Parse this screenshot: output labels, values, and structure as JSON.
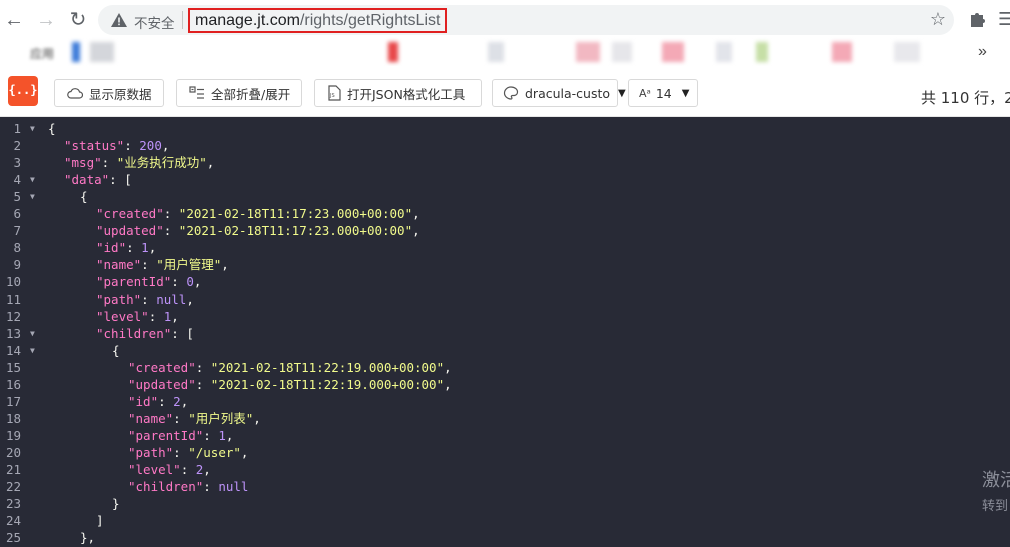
{
  "browser": {
    "security_label": "不安全",
    "url": {
      "host": "manage.jt.com",
      "path": "/rights/getRightsList"
    },
    "bookmarks_first": "应用"
  },
  "toolbar": {
    "logo_text": "{..}",
    "show_raw": "显示原数据",
    "fold_toggle": "全部折叠/展开",
    "open_json_tool": "打开JSON格式化工具",
    "theme": "dracula-custo",
    "font_size": "14",
    "line_count": "共 110 行，2"
  },
  "colors": {
    "editor_bg": "#282a36",
    "key": "#ff79c6",
    "string": "#f1fa8c",
    "number": "#bd93f9",
    "logo": "#f4532a",
    "url_highlight": "#e02020"
  },
  "lines": [
    {
      "n": "1",
      "fold": true,
      "indent": 0,
      "parts": [
        [
          "p",
          "{"
        ]
      ]
    },
    {
      "n": "2",
      "indent": 1,
      "parts": [
        [
          "k",
          "\"status\""
        ],
        [
          "p",
          ": "
        ],
        [
          "n",
          "200"
        ],
        [
          "p",
          ","
        ]
      ]
    },
    {
      "n": "3",
      "indent": 1,
      "parts": [
        [
          "k",
          "\"msg\""
        ],
        [
          "p",
          ": "
        ],
        [
          "s",
          "\"业务执行成功\""
        ],
        [
          "p",
          ","
        ]
      ]
    },
    {
      "n": "4",
      "fold": true,
      "indent": 1,
      "parts": [
        [
          "k",
          "\"data\""
        ],
        [
          "p",
          ": ["
        ]
      ]
    },
    {
      "n": "5",
      "fold": true,
      "indent": 2,
      "parts": [
        [
          "p",
          "{"
        ]
      ]
    },
    {
      "n": "6",
      "indent": 3,
      "parts": [
        [
          "k",
          "\"created\""
        ],
        [
          "p",
          ": "
        ],
        [
          "s",
          "\"2021-02-18T11:17:23.000+00:00\""
        ],
        [
          "p",
          ","
        ]
      ]
    },
    {
      "n": "7",
      "indent": 3,
      "parts": [
        [
          "k",
          "\"updated\""
        ],
        [
          "p",
          ": "
        ],
        [
          "s",
          "\"2021-02-18T11:17:23.000+00:00\""
        ],
        [
          "p",
          ","
        ]
      ]
    },
    {
      "n": "8",
      "indent": 3,
      "parts": [
        [
          "k",
          "\"id\""
        ],
        [
          "p",
          ": "
        ],
        [
          "n",
          "1"
        ],
        [
          "p",
          ","
        ]
      ]
    },
    {
      "n": "9",
      "indent": 3,
      "parts": [
        [
          "k",
          "\"name\""
        ],
        [
          "p",
          ": "
        ],
        [
          "s",
          "\"用户管理\""
        ],
        [
          "p",
          ","
        ]
      ]
    },
    {
      "n": "10",
      "indent": 3,
      "parts": [
        [
          "k",
          "\"parentId\""
        ],
        [
          "p",
          ": "
        ],
        [
          "n",
          "0"
        ],
        [
          "p",
          ","
        ]
      ]
    },
    {
      "n": "11",
      "indent": 3,
      "parts": [
        [
          "k",
          "\"path\""
        ],
        [
          "p",
          ": "
        ],
        [
          "nl",
          "null"
        ],
        [
          "p",
          ","
        ]
      ]
    },
    {
      "n": "12",
      "indent": 3,
      "parts": [
        [
          "k",
          "\"level\""
        ],
        [
          "p",
          ": "
        ],
        [
          "n",
          "1"
        ],
        [
          "p",
          ","
        ]
      ]
    },
    {
      "n": "13",
      "fold": true,
      "indent": 3,
      "parts": [
        [
          "k",
          "\"children\""
        ],
        [
          "p",
          ": ["
        ]
      ]
    },
    {
      "n": "14",
      "fold": true,
      "indent": 4,
      "parts": [
        [
          "p",
          "{"
        ]
      ]
    },
    {
      "n": "15",
      "indent": 5,
      "parts": [
        [
          "k",
          "\"created\""
        ],
        [
          "p",
          ": "
        ],
        [
          "s",
          "\"2021-02-18T11:22:19.000+00:00\""
        ],
        [
          "p",
          ","
        ]
      ]
    },
    {
      "n": "16",
      "indent": 5,
      "parts": [
        [
          "k",
          "\"updated\""
        ],
        [
          "p",
          ": "
        ],
        [
          "s",
          "\"2021-02-18T11:22:19.000+00:00\""
        ],
        [
          "p",
          ","
        ]
      ]
    },
    {
      "n": "17",
      "indent": 5,
      "parts": [
        [
          "k",
          "\"id\""
        ],
        [
          "p",
          ": "
        ],
        [
          "n",
          "2"
        ],
        [
          "p",
          ","
        ]
      ]
    },
    {
      "n": "18",
      "indent": 5,
      "parts": [
        [
          "k",
          "\"name\""
        ],
        [
          "p",
          ": "
        ],
        [
          "s",
          "\"用户列表\""
        ],
        [
          "p",
          ","
        ]
      ]
    },
    {
      "n": "19",
      "indent": 5,
      "parts": [
        [
          "k",
          "\"parentId\""
        ],
        [
          "p",
          ": "
        ],
        [
          "n",
          "1"
        ],
        [
          "p",
          ","
        ]
      ]
    },
    {
      "n": "20",
      "indent": 5,
      "parts": [
        [
          "k",
          "\"path\""
        ],
        [
          "p",
          ": "
        ],
        [
          "s",
          "\"/user\""
        ],
        [
          "p",
          ","
        ]
      ]
    },
    {
      "n": "21",
      "indent": 5,
      "parts": [
        [
          "k",
          "\"level\""
        ],
        [
          "p",
          ": "
        ],
        [
          "n",
          "2"
        ],
        [
          "p",
          ","
        ]
      ]
    },
    {
      "n": "22",
      "indent": 5,
      "parts": [
        [
          "k",
          "\"children\""
        ],
        [
          "p",
          ": "
        ],
        [
          "nl",
          "null"
        ]
      ]
    },
    {
      "n": "23",
      "indent": 4,
      "parts": [
        [
          "p",
          "}"
        ]
      ]
    },
    {
      "n": "24",
      "indent": 3,
      "parts": [
        [
          "p",
          "]"
        ]
      ]
    },
    {
      "n": "25",
      "indent": 2,
      "parts": [
        [
          "p",
          "},"
        ]
      ]
    }
  ],
  "watermark": {
    "title": "激活",
    "subtitle": "转到"
  }
}
